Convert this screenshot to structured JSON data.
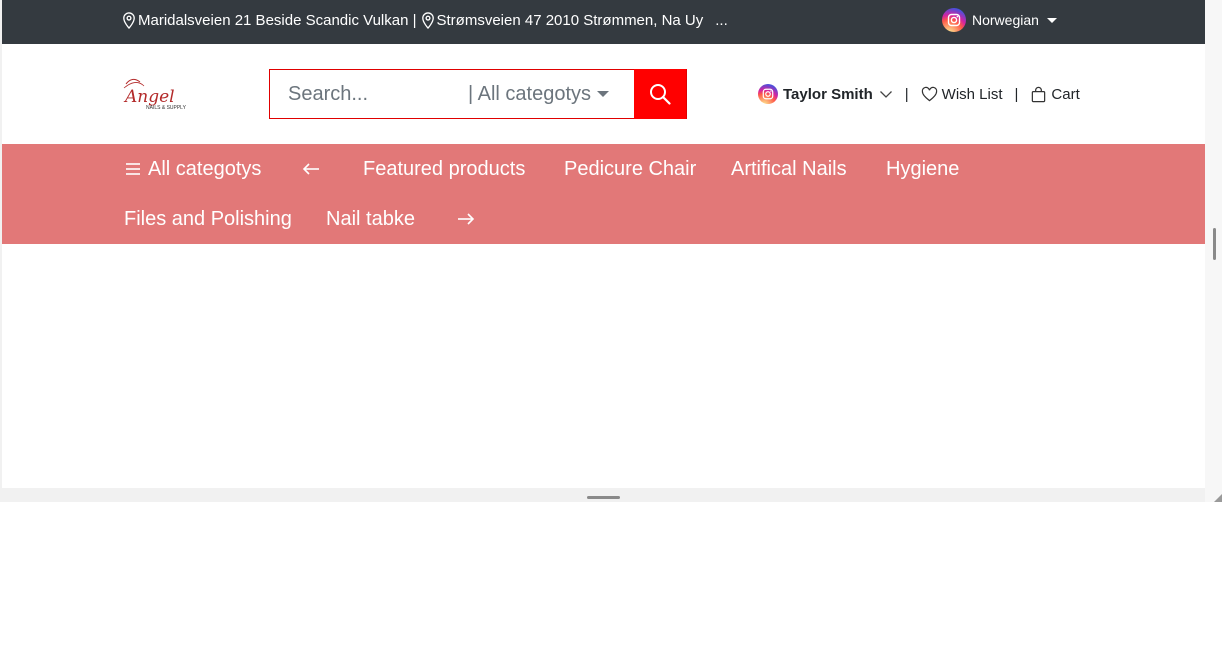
{
  "topbar": {
    "address_1": "Maridalsveien 21 Beside Scandic Vulkan |",
    "address_2": "Strømsveien 47 2010 Strømmen, Na Uy",
    "ellipsis": "...",
    "language": "Norwegian"
  },
  "header": {
    "logo_text": "Angel",
    "logo_subtext": "NAILS & SUPPLY",
    "search_placeholder": "Search...",
    "category_select": "| All categotys",
    "user_name": "Taylor Smith",
    "separator": "|",
    "wishlist_label": "Wish List",
    "cart_label": "Cart"
  },
  "nav": {
    "all_categories": "All categotys",
    "items": [
      "Featured products",
      "Pedicure Chair",
      "Artifical Nails",
      "Hygiene",
      "Files and Polishing",
      "Nail tabke"
    ]
  },
  "colors": {
    "topbar_bg": "#343a40",
    "nav_bg": "#e27878",
    "search_button": "#ff0000",
    "search_border": "#e00000"
  },
  "icons": [
    "map-pin-icon",
    "instagram-icon",
    "search-icon",
    "chevron-down-icon",
    "heart-icon",
    "shopping-bag-icon",
    "hamburger-icon",
    "arrow-left-icon",
    "arrow-right-icon"
  ]
}
